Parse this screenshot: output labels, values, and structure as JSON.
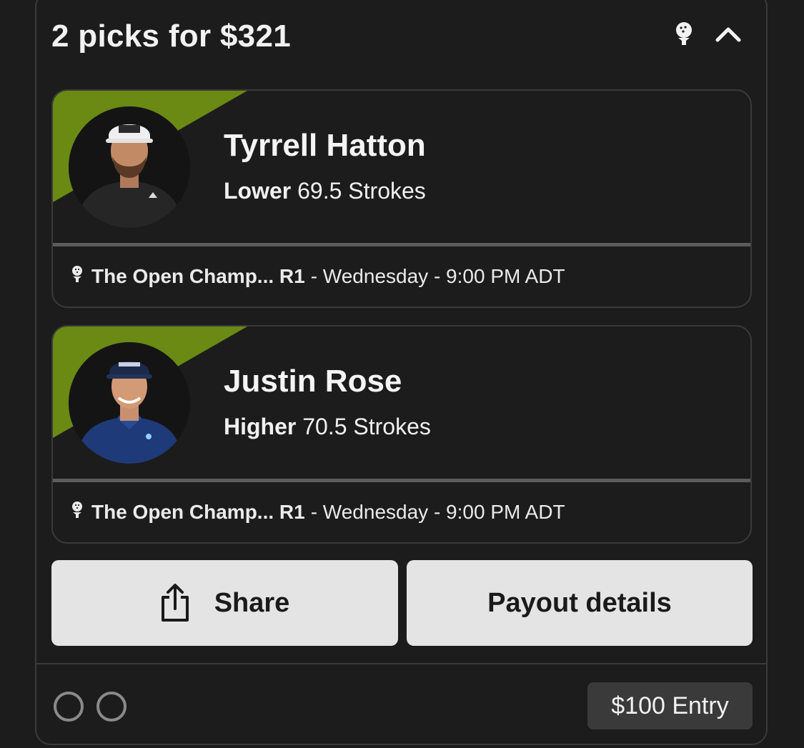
{
  "header": {
    "title": "2 picks for $321",
    "sport_icon": "golf-ball-tee-icon",
    "collapse_icon": "chevron-up-icon"
  },
  "picks": [
    {
      "player_name": "Tyrrell Hatton",
      "direction": "Lower",
      "projection": "69.5 Strokes",
      "event_icon": "golf-ball-tee-icon",
      "event_name": "The Open Champ... R1",
      "event_detail": "- Wednesday - 9:00 PM ADT",
      "avatar": "player-headshot"
    },
    {
      "player_name": "Justin Rose",
      "direction": "Higher",
      "projection": "70.5 Strokes",
      "event_icon": "golf-ball-tee-icon",
      "event_name": "The Open Champ... R1",
      "event_detail": "- Wednesday - 9:00 PM ADT",
      "avatar": "player-headshot"
    }
  ],
  "actions": {
    "share_label": "Share",
    "share_icon": "share-upload-icon",
    "payout_label": "Payout details"
  },
  "footer": {
    "entry_label": "$100 Entry"
  },
  "colors": {
    "background": "#1c1c1c",
    "accent_wedge": "#6a8a14",
    "button_bg": "#e4e4e4",
    "entry_badge_bg": "#3a3a3a"
  }
}
